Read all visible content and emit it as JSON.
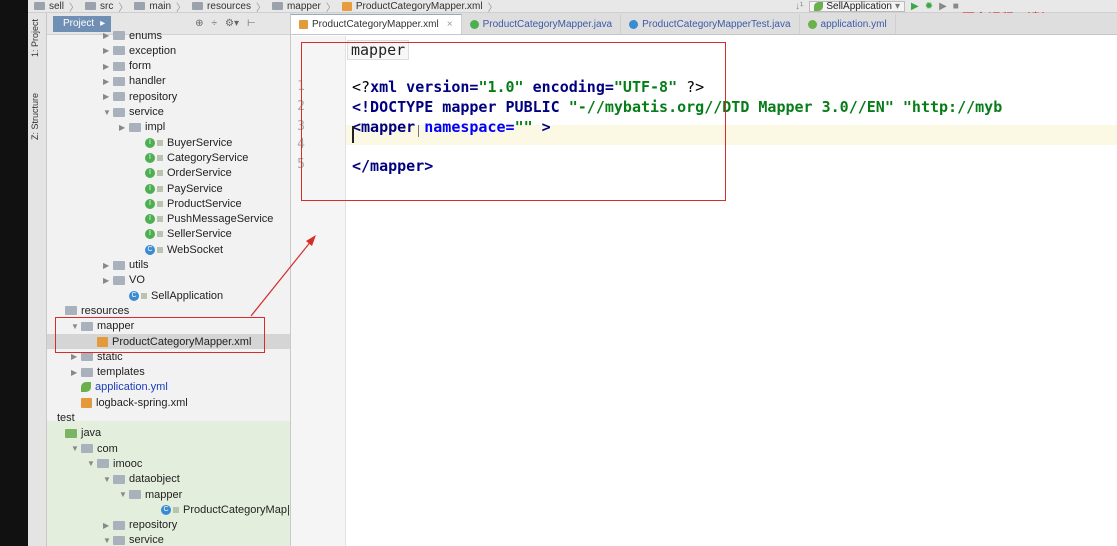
{
  "breadcrumb": [
    "sell",
    "src",
    "main",
    "resources",
    "mapper",
    "ProductCategoryMapper.xml"
  ],
  "run_config": {
    "name": "SellApplication"
  },
  "watermark": "更多课程，请加qq:484",
  "side_tabs": {
    "project": "1: Project",
    "structure": "Z: Structure"
  },
  "project_panel": {
    "title": "Project"
  },
  "tree": [
    {
      "label": "enums",
      "indent": 3,
      "type": "folder",
      "twist": "right"
    },
    {
      "label": "exception",
      "indent": 3,
      "type": "folder",
      "twist": "right"
    },
    {
      "label": "form",
      "indent": 3,
      "type": "folder",
      "twist": "right"
    },
    {
      "label": "handler",
      "indent": 3,
      "type": "folder",
      "twist": "right"
    },
    {
      "label": "repository",
      "indent": 3,
      "type": "folder",
      "twist": "right"
    },
    {
      "label": "service",
      "indent": 3,
      "type": "folder",
      "twist": "down"
    },
    {
      "label": "impl",
      "indent": 4,
      "type": "folder",
      "twist": "right"
    },
    {
      "label": "BuyerService",
      "indent": 5,
      "type": "interface"
    },
    {
      "label": "CategoryService",
      "indent": 5,
      "type": "interface"
    },
    {
      "label": "OrderService",
      "indent": 5,
      "type": "interface"
    },
    {
      "label": "PayService",
      "indent": 5,
      "type": "interface"
    },
    {
      "label": "ProductService",
      "indent": 5,
      "type": "interface"
    },
    {
      "label": "PushMessageService",
      "indent": 5,
      "type": "interface"
    },
    {
      "label": "SellerService",
      "indent": 5,
      "type": "interface"
    },
    {
      "label": "WebSocket",
      "indent": 5,
      "type": "class"
    },
    {
      "label": "utils",
      "indent": 3,
      "type": "folder",
      "twist": "right"
    },
    {
      "label": "VO",
      "indent": 3,
      "type": "folder",
      "twist": "right"
    },
    {
      "label": "SellApplication",
      "indent": 4,
      "type": "app"
    },
    {
      "label": "resources",
      "indent": 0,
      "type": "folder"
    },
    {
      "label": "mapper",
      "indent": 1,
      "type": "folder",
      "twist": "down"
    },
    {
      "label": "ProductCategoryMapper.xml",
      "indent": 2,
      "type": "xml",
      "selected": true
    },
    {
      "label": "static",
      "indent": 1,
      "type": "folder",
      "twist": "right"
    },
    {
      "label": "templates",
      "indent": 1,
      "type": "folder",
      "twist": "right"
    },
    {
      "label": "application.yml",
      "indent": 1,
      "type": "yml"
    },
    {
      "label": "logback-spring.xml",
      "indent": 1,
      "type": "xml"
    },
    {
      "label": "test",
      "indent": -1,
      "type": "plain"
    },
    {
      "label": "java",
      "indent": 0,
      "type": "folder-green"
    },
    {
      "label": "com",
      "indent": 1,
      "type": "folder",
      "twist": "down"
    },
    {
      "label": "imooc",
      "indent": 2,
      "type": "folder",
      "twist": "down"
    },
    {
      "label": "dataobject",
      "indent": 3,
      "type": "folder",
      "twist": "down"
    },
    {
      "label": "mapper",
      "indent": 4,
      "type": "folder",
      "twist": "down"
    },
    {
      "label": "ProductCategoryMap|",
      "indent": 6,
      "type": "class"
    },
    {
      "label": "repository",
      "indent": 3,
      "type": "folder",
      "twist": "right"
    },
    {
      "label": "service",
      "indent": 3,
      "type": "folder",
      "twist": "down"
    }
  ],
  "editor_tabs": [
    {
      "label": "ProductCategoryMapper.xml",
      "active": true,
      "icon": "xml"
    },
    {
      "label": "ProductCategoryMapper.java",
      "active": false,
      "icon": "interface"
    },
    {
      "label": "ProductCategoryMapperTest.java",
      "active": false,
      "icon": "class"
    },
    {
      "label": "application.yml",
      "active": false,
      "icon": "yml"
    }
  ],
  "line_numbers": [
    "1",
    "2",
    "3",
    "4",
    "5"
  ],
  "code": {
    "line1": {
      "a": "<?",
      "b": "xml version",
      "c": "=",
      "d": "\"1.0\"",
      "e": " encoding",
      "f": "=",
      "g": "\"UTF-8\"",
      "h": " ?>"
    },
    "line2": {
      "a": "<!DOCTYPE mapper PUBLIC ",
      "b": "\"-//mybatis.org//DTD Mapper 3.0//EN\"",
      "c": " \"http://myb"
    },
    "line3": {
      "a": "<mapper ",
      "b": "namespace",
      "c": "=",
      "d": "\"\"",
      "e": " >"
    },
    "line5": {
      "a": "</mapper>"
    }
  },
  "hint_text": "mapper"
}
